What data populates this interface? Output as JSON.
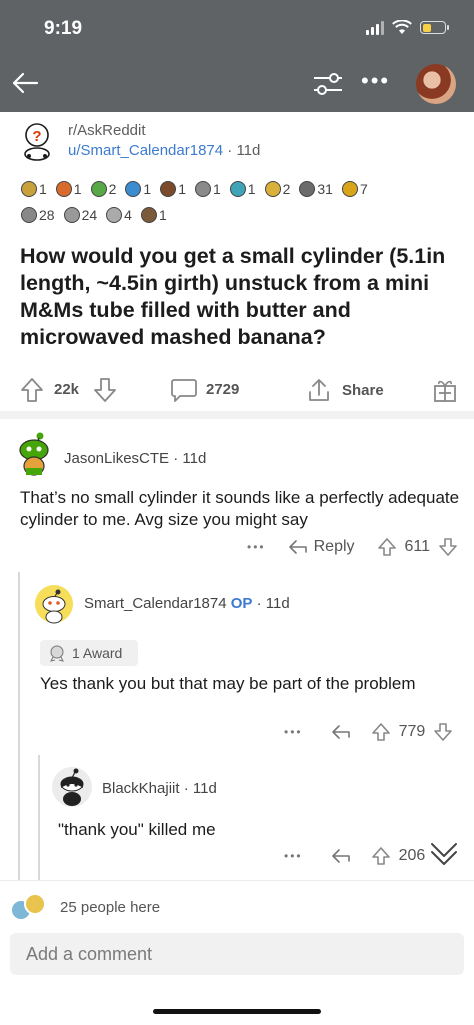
{
  "status_bar": {
    "time": "9:19",
    "battery_level": 0.4,
    "battery_color": "#f7d046"
  },
  "nav": {
    "more_label": "•••"
  },
  "post": {
    "subreddit": "r/AskReddit",
    "author_prefix": "u/",
    "author": "Smart_Calendar1874",
    "age": "· 11d",
    "awards_row1": [
      {
        "icon": "award-icon",
        "count": "1"
      },
      {
        "icon": "award-icon",
        "count": "1"
      },
      {
        "icon": "award-icon",
        "count": "2"
      },
      {
        "icon": "award-icon",
        "count": "1"
      },
      {
        "icon": "award-icon",
        "count": "1"
      },
      {
        "icon": "award-icon",
        "count": "1"
      },
      {
        "icon": "award-icon",
        "count": "1"
      },
      {
        "icon": "award-icon",
        "count": "2"
      },
      {
        "icon": "award-icon",
        "count": "31"
      },
      {
        "icon": "award-icon",
        "count": "7"
      }
    ],
    "awards_row2": [
      {
        "icon": "award-icon",
        "count": "28"
      },
      {
        "icon": "award-icon",
        "count": "24"
      },
      {
        "icon": "award-icon",
        "count": "4"
      },
      {
        "icon": "award-icon",
        "count": "1"
      }
    ],
    "title": "How would you get a small cylinder (5.1in length, ~4.5in girth) unstuck from a mini M&Ms tube filled with butter and microwaved mashed banana?",
    "votes": "22k",
    "comments": "2729",
    "share_label": "Share"
  },
  "comments": [
    {
      "user": "JasonLikesCTE",
      "age": " · 11d",
      "body": "That’s no small cylinder it sounds like a perfectly adequate cylinder to me. Avg size you might say",
      "reply_label": "Reply",
      "votes": "611"
    },
    {
      "user": "Smart_Calendar1874",
      "op_label": "OP",
      "age": " · 11d",
      "award_chip": "1 Award",
      "body": "Yes thank you but that may be part of the problem",
      "votes": "779"
    },
    {
      "user": "BlackKhajiit",
      "age": " · 11d",
      "body": "\"thank you\" killed me",
      "votes": "206"
    }
  ],
  "more_label": "•••",
  "footer": {
    "people_here": "25 people here",
    "comment_placeholder": "Add a comment"
  }
}
